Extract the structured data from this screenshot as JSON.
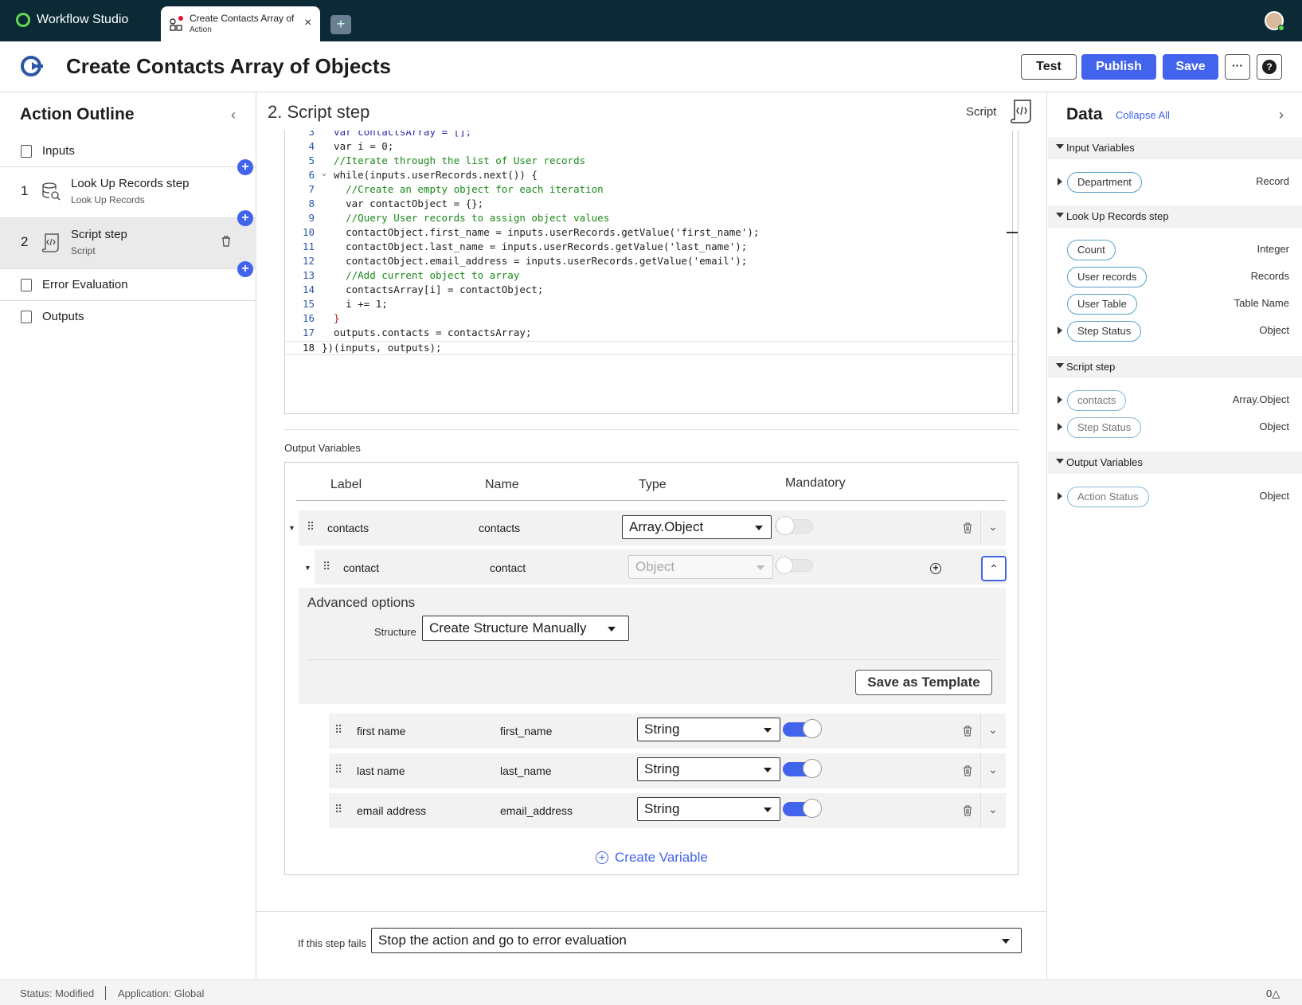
{
  "app": {
    "name": "Workflow Studio"
  },
  "tab": {
    "title": "Create Contacts Array of Objects",
    "subtitle": "Action",
    "close": "×",
    "add": "+"
  },
  "header": {
    "title": "Create Contacts Array of Objects",
    "test_label": "Test",
    "publish_label": "Publish",
    "save_label": "Save",
    "more_label": "···",
    "help_label": "?"
  },
  "outline": {
    "title": "Action Outline",
    "collapse": "‹",
    "inputs_label": "Inputs",
    "steps": [
      {
        "num": "1",
        "title": "Look Up Records step",
        "subtitle": "Look Up Records"
      },
      {
        "num": "2",
        "title": "Script step",
        "subtitle": "Script"
      }
    ],
    "error_label": "Error Evaluation",
    "outputs_label": "Outputs",
    "plus": "+"
  },
  "step": {
    "title": "2.  Script step",
    "type_label": "Script"
  },
  "code": {
    "lines": [
      {
        "n": "3",
        "text": "  var contactsArray = [];"
      },
      {
        "n": "4",
        "text": "  var i = 0;"
      },
      {
        "n": "5",
        "text": "  //Iterate through the list of User records"
      },
      {
        "n": "6",
        "text": "  while(inputs.userRecords.next()) {",
        "fold": "⌄"
      },
      {
        "n": "7",
        "text": "    //Create an empty object for each iteration"
      },
      {
        "n": "8",
        "text": "    var contactObject = {};"
      },
      {
        "n": "9",
        "text": "    //Query User records to assign object values"
      },
      {
        "n": "10",
        "text": "    contactObject.first_name = inputs.userRecords.getValue('first_name');"
      },
      {
        "n": "11",
        "text": "    contactObject.last_name = inputs.userRecords.getValue('last_name');"
      },
      {
        "n": "12",
        "text": "    contactObject.email_address = inputs.userRecords.getValue('email');"
      },
      {
        "n": "13",
        "text": "    //Add current object to array"
      },
      {
        "n": "14",
        "text": "    contactsArray[i] = contactObject;"
      },
      {
        "n": "15",
        "text": "    i += 1;"
      },
      {
        "n": "16",
        "text": "  }"
      },
      {
        "n": "17",
        "text": "  outputs.contacts = contactsArray;"
      },
      {
        "n": "18",
        "text": "})(inputs, outputs);"
      }
    ]
  },
  "output_vars": {
    "title": "Output Variables",
    "columns": {
      "label": "Label",
      "name": "Name",
      "type": "Type",
      "mandatory": "Mandatory"
    },
    "contacts": {
      "label": "contacts",
      "name": "contacts",
      "type": "Array.Object"
    },
    "contact": {
      "label": "contact",
      "name": "contact",
      "type": "Object"
    },
    "advanced": {
      "title": "Advanced options",
      "structure_label": "Structure",
      "structure_value": "Create Structure Manually",
      "template_label": "Save as Template"
    },
    "children": [
      {
        "label": "first name",
        "name": "first_name",
        "type": "String"
      },
      {
        "label": "last name",
        "name": "last_name",
        "type": "String"
      },
      {
        "label": "email address",
        "name": "email_address",
        "type": "String"
      }
    ],
    "create_label": "Create Variable"
  },
  "fail": {
    "label": "If this step fails",
    "value": "Stop the action and go to error evaluation"
  },
  "data_panel": {
    "title": "Data",
    "collapse_all": "Collapse All",
    "chevron": "›",
    "sections": {
      "input": {
        "title": "Input Variables",
        "items": [
          {
            "label": "Department",
            "type": "Record"
          }
        ]
      },
      "lookup": {
        "title": "Look Up Records step",
        "items": [
          {
            "label": "Count",
            "type": "Integer"
          },
          {
            "label": "User records",
            "type": "Records"
          },
          {
            "label": "User Table",
            "type": "Table Name"
          },
          {
            "label": "Step Status",
            "type": "Object"
          }
        ]
      },
      "script": {
        "title": "Script step",
        "items": [
          {
            "label": "contacts",
            "type": "Array.Object"
          },
          {
            "label": "Step Status",
            "type": "Object"
          }
        ]
      },
      "output": {
        "title": "Output Variables",
        "items": [
          {
            "label": "Action Status",
            "type": "Object"
          }
        ]
      }
    }
  },
  "status": {
    "status": "Status: Modified",
    "application": "Application: Global",
    "count": "0△"
  },
  "colors": {
    "accent": "#4263eb",
    "topbar": "#0b2a36",
    "brand_green": "#62d84e"
  }
}
